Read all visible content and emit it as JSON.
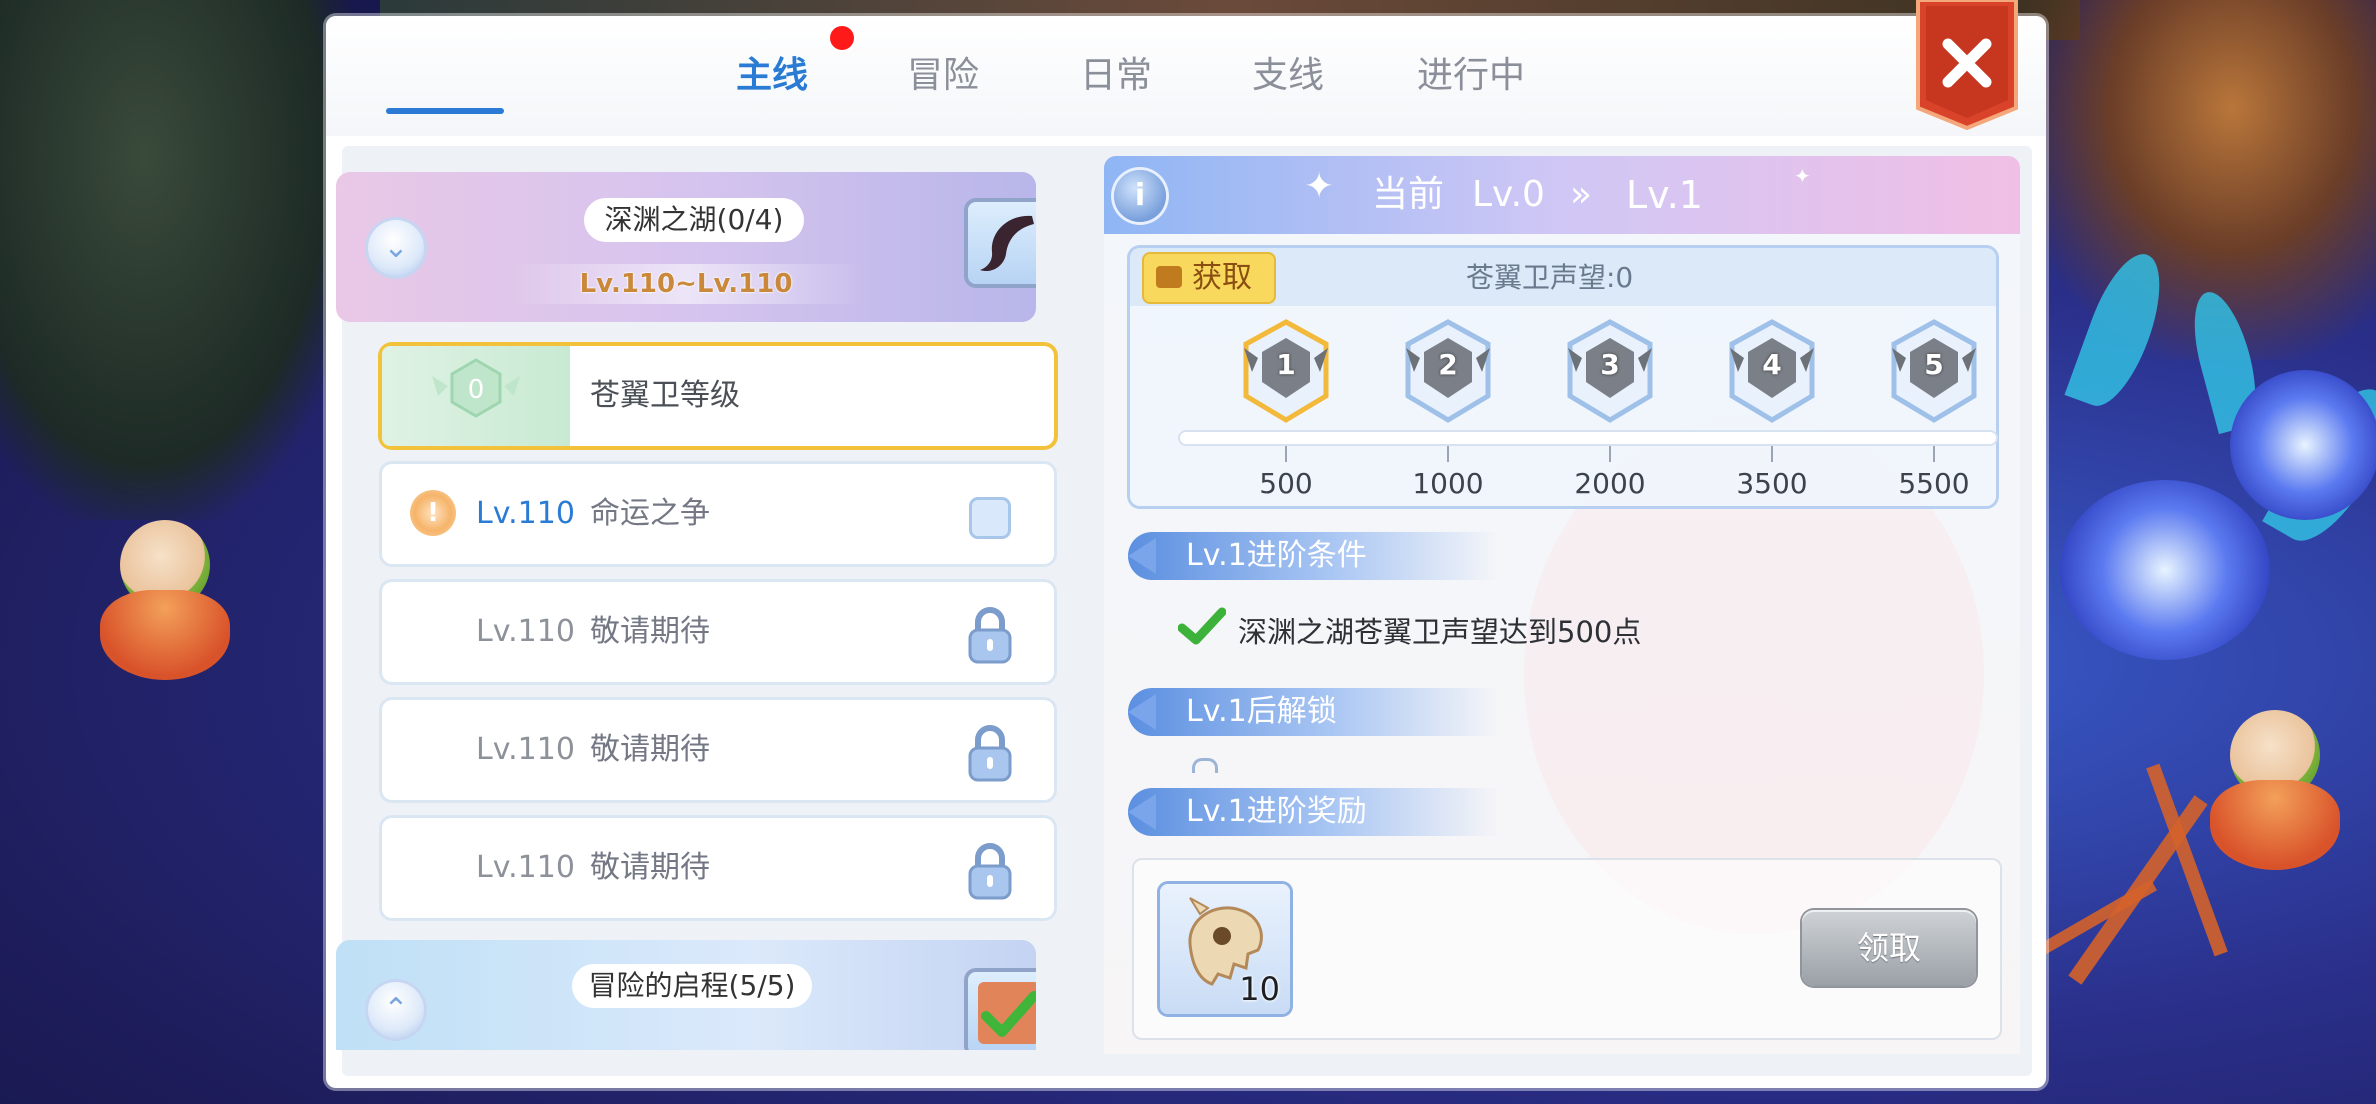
{
  "tabs": [
    {
      "label": "主线",
      "active": true
    },
    {
      "label": "冒险"
    },
    {
      "label": "日常",
      "badge": "red-dot"
    },
    {
      "label": "支线"
    },
    {
      "label": "进行中"
    }
  ],
  "close_icon": "close-icon",
  "chapters": [
    {
      "title": "深渊之湖(0/4)",
      "level_range": "Lv.110~Lv.110",
      "state": "expanded",
      "toggle_icon": "chevron-down-icon"
    },
    {
      "title": "冒险的启程(5/5)",
      "state": "collapsed",
      "toggle_icon": "chevron-up-icon"
    }
  ],
  "quests": [
    {
      "badge": "0",
      "name": "苍翼卫等级",
      "selected": true
    },
    {
      "level": "Lv.110",
      "name": "命运之争",
      "status_icon": "warning-icon"
    },
    {
      "level": "Lv.110",
      "name": "敬请期待",
      "status_icon": "lock-icon"
    },
    {
      "level": "Lv.110",
      "name": "敬请期待",
      "status_icon": "lock-icon"
    },
    {
      "level": "Lv.110",
      "name": "敬请期待",
      "status_icon": "lock-icon"
    }
  ],
  "header": {
    "current_label": "当前",
    "from_level": "Lv.0",
    "arrow": "»",
    "to_level": "Lv.1"
  },
  "reputation": {
    "obtain_label": "获取",
    "label": "苍翼卫声望:0",
    "milestones": [
      {
        "rank": "1",
        "threshold": "500",
        "reached": false,
        "current": true
      },
      {
        "rank": "2",
        "threshold": "1000"
      },
      {
        "rank": "3",
        "threshold": "2000"
      },
      {
        "rank": "4",
        "threshold": "3500"
      },
      {
        "rank": "5",
        "threshold": "5500"
      }
    ],
    "progress": 0
  },
  "sections": {
    "conditions_title": "Lv.1进阶条件",
    "condition_text": "深渊之湖苍翼卫声望达到500点",
    "unlock_title": "Lv.1后解锁",
    "rewards_title": "Lv.1进阶奖励"
  },
  "reward": {
    "icon": "beast-skull-icon",
    "count": "10",
    "claim_label": "领取"
  },
  "colors": {
    "accent": "#2a7bd4",
    "highlight": "#f2c23a",
    "close": "#d8432a"
  }
}
